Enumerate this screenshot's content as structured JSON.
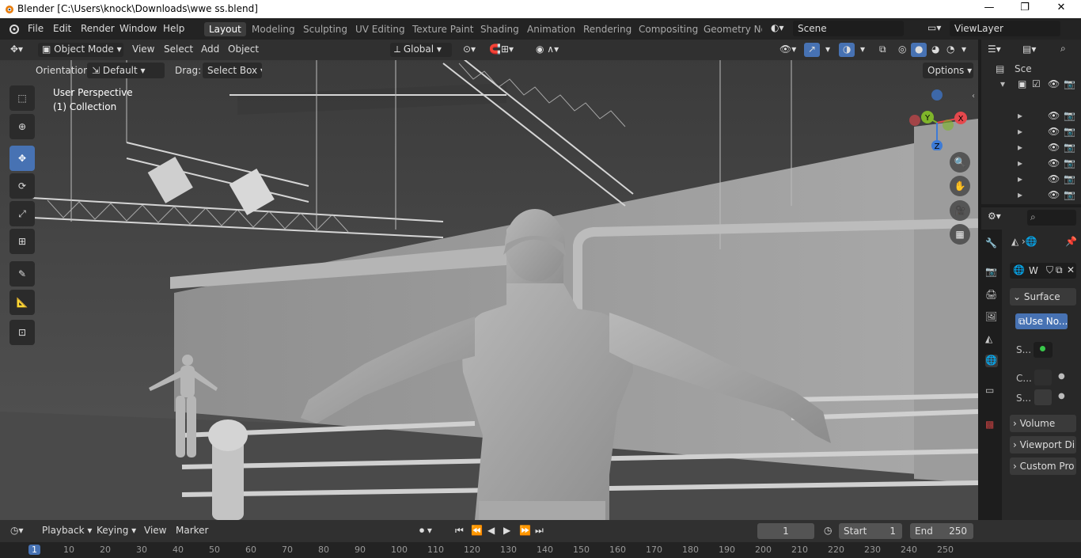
{
  "window": {
    "title": "Blender [C:\\Users\\knock\\Downloads\\wwe ss.blend]",
    "controls": [
      "—",
      "❐",
      "✕"
    ]
  },
  "menu": [
    "File",
    "Edit",
    "Render",
    "Window",
    "Help"
  ],
  "workspaces": [
    "Layout",
    "Modeling",
    "Sculpting",
    "UV Editing",
    "Texture Paint",
    "Shading",
    "Animation",
    "Rendering",
    "Compositing",
    "Geometry Noc"
  ],
  "scene": {
    "name": "Scene",
    "view_layer": "ViewLayer"
  },
  "viewport_header": {
    "mode": "Object Mode",
    "menus": [
      "View",
      "Select",
      "Add",
      "Object"
    ],
    "transform": "Global"
  },
  "tool_header": {
    "orientation_label": "Orientation:",
    "orientation_value": "Default",
    "drag_label": "Drag:",
    "drag_value": "Select Box",
    "options": "Options"
  },
  "viewport": {
    "perspective": "User Perspective",
    "collection": "(1) Collection",
    "gizmo": {
      "x": "X",
      "y": "Y",
      "z": "Z"
    }
  },
  "outliner": {
    "scene_label": "Sce",
    "row_count": 7
  },
  "properties": {
    "world_name": "W",
    "surface": "Surface",
    "use_nodes": "Use No...",
    "s1": "S...",
    "c": "C...",
    "s2": "S...",
    "volume": "Volume",
    "viewport_display": "Viewport Di",
    "custom_props": "Custom Pro"
  },
  "timeline": {
    "menus": [
      "Playback",
      "Keying",
      "View",
      "Marker"
    ],
    "current_frame": "1",
    "start_label": "Start",
    "start_value": "1",
    "end_label": "End",
    "end_value": "250",
    "ruler": [
      "1",
      "10",
      "20",
      "30",
      "40",
      "50",
      "60",
      "70",
      "80",
      "90",
      "100",
      "110",
      "120",
      "130",
      "140",
      "150",
      "160",
      "170",
      "180",
      "190",
      "200",
      "210",
      "220",
      "230",
      "240",
      "250"
    ]
  },
  "colors": {
    "accent": "#4772b3",
    "x_axis": "#e5484d",
    "y_axis": "#7fb52a",
    "z_axis": "#3d7bd6"
  }
}
